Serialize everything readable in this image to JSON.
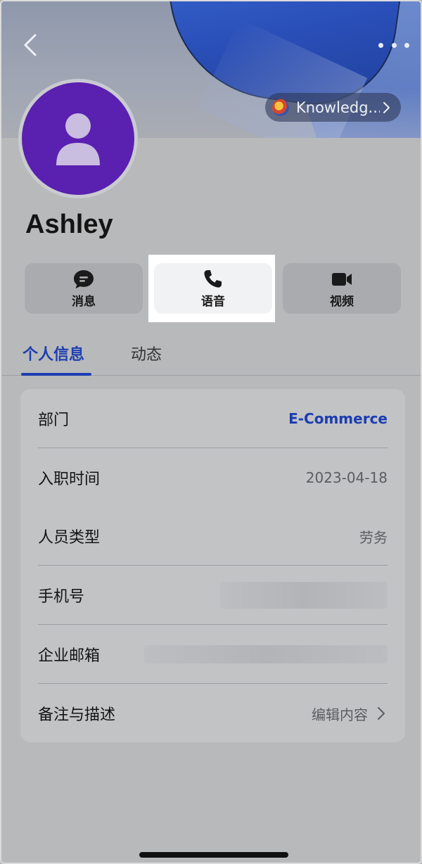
{
  "header": {
    "knowledge_chip": "Knowledg..."
  },
  "profile": {
    "name": "Ashley"
  },
  "actions": {
    "message": "消息",
    "voice": "语音",
    "video": "视频"
  },
  "tabs": {
    "personal_info": "个人信息",
    "activity": "动态"
  },
  "info": {
    "department": {
      "label": "部门",
      "value": "E-Commerce"
    },
    "hire_date": {
      "label": "入职时间",
      "value": "2023-04-18"
    },
    "staff_type": {
      "label": "人员类型",
      "value": "劳务"
    },
    "phone": {
      "label": "手机号"
    },
    "email": {
      "label": "企业邮箱"
    },
    "notes": {
      "label": "备注与描述",
      "value": "编辑内容"
    }
  },
  "colors": {
    "accent": "#1e3fb0",
    "avatar_bg": "#5a20b0"
  }
}
